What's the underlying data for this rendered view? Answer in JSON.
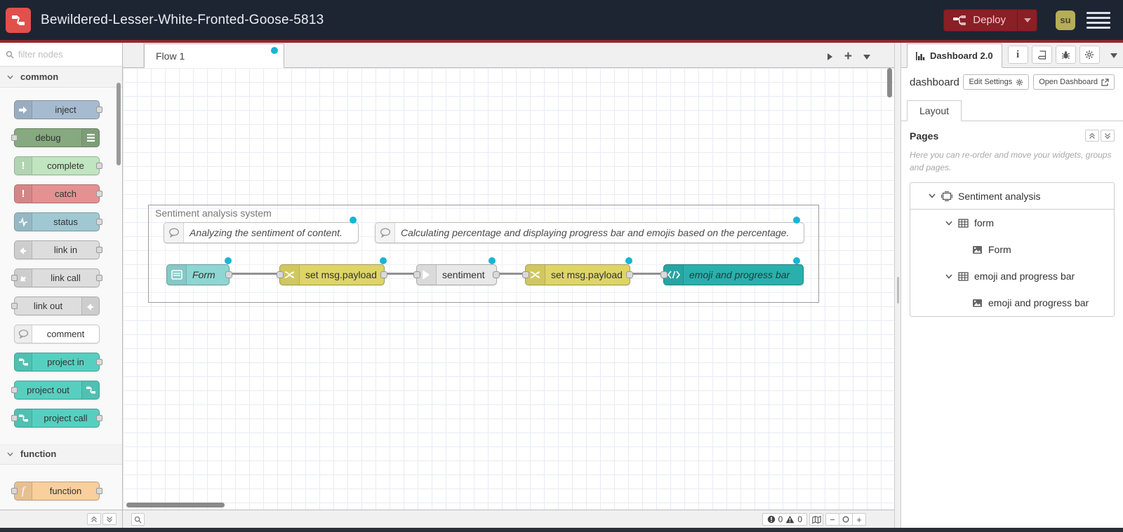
{
  "header": {
    "title": "Bewildered-Lesser-White-Fronted-Goose-5813",
    "deploy_label": "Deploy",
    "user_initials": "su"
  },
  "palette": {
    "filter_placeholder": "filter nodes",
    "categories": [
      {
        "label": "common"
      },
      {
        "label": "function"
      }
    ],
    "nodes": [
      {
        "label": "inject",
        "icon": "inject-arrow-icon",
        "color": "#a6bbcf",
        "ports": "out",
        "icon_side": "left"
      },
      {
        "label": "debug",
        "icon": "debug-list-icon",
        "color": "#87a980",
        "ports": "in",
        "icon_side": "right"
      },
      {
        "label": "complete",
        "icon": "exclamation-icon",
        "color": "#c0e5c0",
        "ports": "out",
        "icon_side": "left"
      },
      {
        "label": "catch",
        "icon": "exclamation-icon",
        "color": "#e49191",
        "ports": "out",
        "icon_side": "left"
      },
      {
        "label": "status",
        "icon": "pulse-icon",
        "color": "#a0c8d2",
        "ports": "out",
        "icon_side": "left"
      },
      {
        "label": "link in",
        "icon": "link-icon",
        "color": "#dddddd",
        "ports": "out",
        "icon_side": "left"
      },
      {
        "label": "link call",
        "icon": "link-icon",
        "color": "#dddddd",
        "ports": "both",
        "icon_side": "left"
      },
      {
        "label": "link out",
        "icon": "link-icon",
        "color": "#dddddd",
        "ports": "in",
        "icon_side": "right"
      },
      {
        "label": "comment",
        "icon": "comment-bubble-icon",
        "color": "#ffffff",
        "ports": "none",
        "icon_side": "left"
      },
      {
        "label": "project in",
        "icon": "node-red-icon",
        "color": "#57cfc0",
        "ports": "out",
        "icon_side": "left"
      },
      {
        "label": "project out",
        "icon": "node-red-icon",
        "color": "#57cfc0",
        "ports": "in",
        "icon_side": "right"
      },
      {
        "label": "project call",
        "icon": "node-red-icon",
        "color": "#57cfc0",
        "ports": "both",
        "icon_side": "left"
      },
      {
        "label": "function",
        "icon": "function-f-icon",
        "color": "#f9cf9d",
        "ports": "both",
        "icon_side": "left"
      }
    ]
  },
  "workspace": {
    "tab_label": "Flow 1",
    "group_label": "Sentiment analysis system",
    "comments": [
      {
        "text": "Analyzing the sentiment of content.",
        "icon": "comment-bubble-icon"
      },
      {
        "text": "Calculating percentage and displaying progress bar and emojis based on the percentage.",
        "icon": "comment-bubble-icon"
      }
    ],
    "nodes": [
      {
        "label": "Form",
        "icon": "form-icon",
        "color": "#8ed6d3"
      },
      {
        "label": "set msg.payload",
        "icon": "change-icon",
        "color": "#ded468"
      },
      {
        "label": "sentiment",
        "icon": "arrow-icon",
        "color": "#e8e8e8"
      },
      {
        "label": "set msg.payload",
        "icon": "change-icon",
        "color": "#ded468"
      },
      {
        "label": "emoji and progress bar",
        "icon": "code-icon",
        "color": "#2bafad"
      }
    ],
    "footer": {
      "error_count": "0",
      "warning_count": "0"
    }
  },
  "sidebar": {
    "tab_label": "Dashboard 2.0",
    "toolbar": {
      "name": "dashboard",
      "edit_settings_label": "Edit Settings",
      "open_dashboard_label": "Open Dashboard"
    },
    "layout_tab_label": "Layout",
    "pages": {
      "title": "Pages",
      "help_text": "Here you can re-order and move your widgets, groups and pages.",
      "tree": [
        {
          "label": "Sentiment analysis",
          "icon": "page-icon",
          "depth": 0
        },
        {
          "label": "form",
          "icon": "group-icon",
          "depth": 1
        },
        {
          "label": "Form",
          "icon": "widget-icon",
          "depth": 2
        },
        {
          "label": "emoji and progress bar",
          "icon": "group-icon",
          "depth": 1
        },
        {
          "label": "emoji and progress bar",
          "icon": "widget-icon",
          "depth": 2
        }
      ]
    }
  },
  "colors": {
    "header_bg": "#1d2533",
    "accent_red": "#8e2a2a",
    "deploy_bg": "#8a1f26",
    "avatar_bg": "#b5ad57",
    "modified_dot": "#15b6d6",
    "logo_red": "#e2504c"
  }
}
